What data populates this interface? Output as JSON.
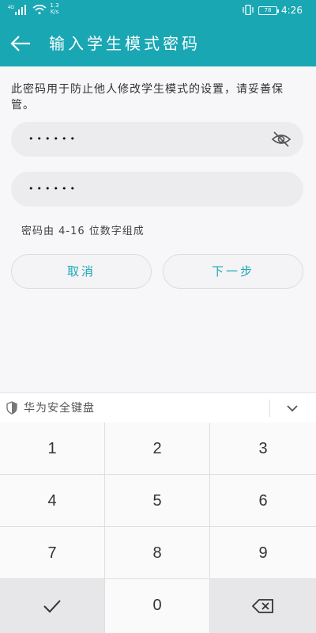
{
  "status_bar": {
    "network": "4G",
    "speed_value": "1.3",
    "speed_unit": "K/s",
    "battery": "78",
    "time": "4:26"
  },
  "header": {
    "title": "输入学生模式密码"
  },
  "main": {
    "description": "此密码用于防止他人修改学生模式的设置，请妥善保管。",
    "password_dots": "••••••",
    "confirm_dots": "••••••",
    "hint": "密码由 4-16 位数字组成",
    "cancel_label": "取消",
    "next_label": "下一步"
  },
  "keyboard": {
    "title": "华为安全键盘",
    "keys": [
      "1",
      "2",
      "3",
      "4",
      "5",
      "6",
      "7",
      "8",
      "9",
      "0"
    ]
  },
  "colors": {
    "accent": "#1aa7b4"
  },
  "icons": [
    "back-arrow-icon",
    "eye-hidden-icon",
    "shield-icon",
    "chevron-down-icon",
    "checkmark-icon",
    "backspace-icon"
  ]
}
